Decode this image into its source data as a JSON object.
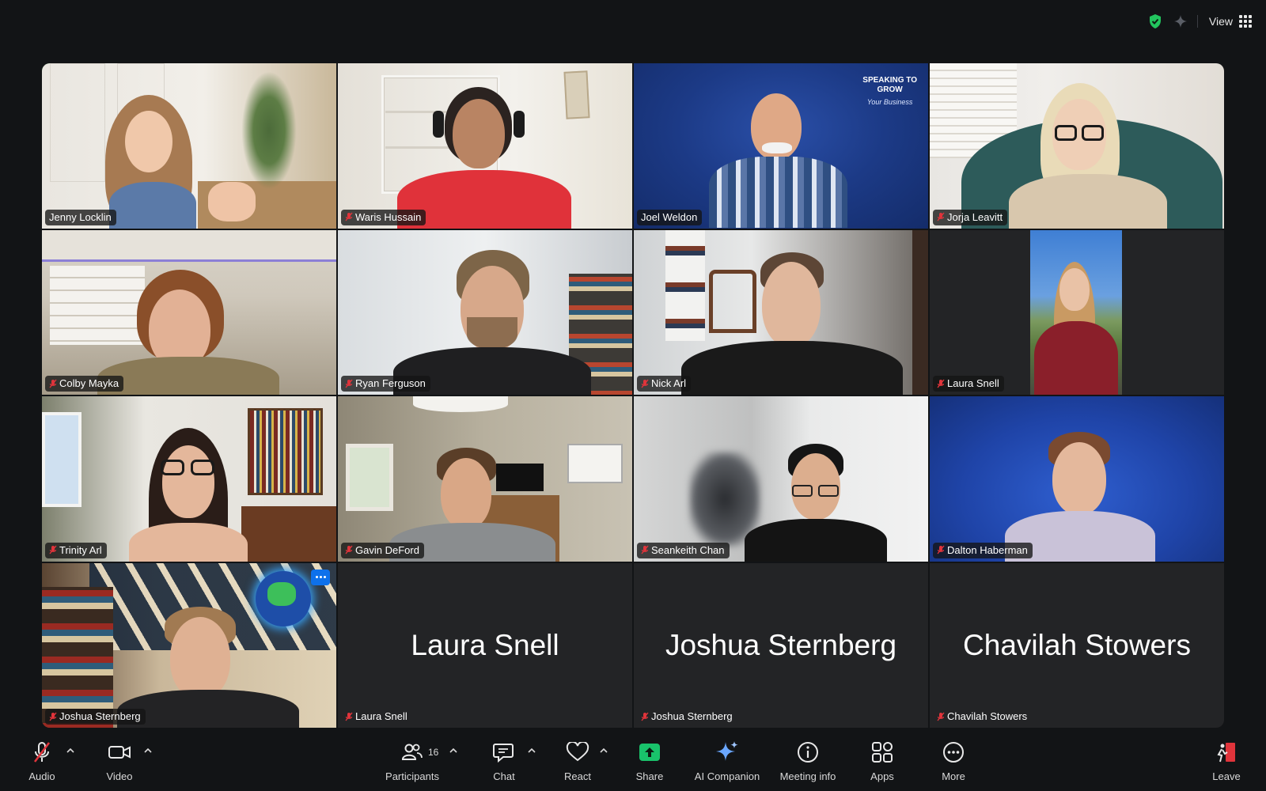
{
  "topbar": {
    "view_label": "View"
  },
  "participants": [
    {
      "name": "Jenny Locklin",
      "muted": false,
      "active": true
    },
    {
      "name": "Waris Hussain",
      "muted": true
    },
    {
      "name": "Joel Weldon",
      "muted": false,
      "banner": {
        "line1": "SPEAKING TO",
        "line2": "GROW",
        "line3": "Your Business"
      }
    },
    {
      "name": "Jorja Leavitt",
      "muted": true
    },
    {
      "name": "Colby Mayka",
      "muted": true
    },
    {
      "name": "Ryan Ferguson",
      "muted": true
    },
    {
      "name": "Nick Arl",
      "muted": true
    },
    {
      "name": "Laura Snell",
      "muted": true
    },
    {
      "name": "Trinity Arl",
      "muted": true
    },
    {
      "name": "Gavin DeFord",
      "muted": true
    },
    {
      "name": "Seankeith Chan",
      "muted": true
    },
    {
      "name": "Dalton Haberman",
      "muted": true
    },
    {
      "name": "Joshua Sternberg",
      "muted": true
    },
    {
      "name": "Laura Snell",
      "muted": true,
      "video_off": true,
      "display_name": "Laura Snell"
    },
    {
      "name": "Joshua Sternberg",
      "muted": true,
      "video_off": true,
      "display_name": "Joshua Sternberg"
    },
    {
      "name": "Chavilah Stowers",
      "muted": true,
      "video_off": true,
      "display_name": "Chavilah Stowers"
    }
  ],
  "toolbar": {
    "audio": "Audio",
    "video": "Video",
    "participants": "Participants",
    "participants_count": "16",
    "chat": "Chat",
    "react": "React",
    "share": "Share",
    "ai_companion": "AI Companion",
    "meeting_info": "Meeting info",
    "apps": "Apps",
    "more": "More",
    "leave": "Leave"
  },
  "colors": {
    "accent_green": "#22c55e",
    "share_green": "#19c36b",
    "mute_red": "#e0343b",
    "active_border": "#2fbf3a"
  }
}
